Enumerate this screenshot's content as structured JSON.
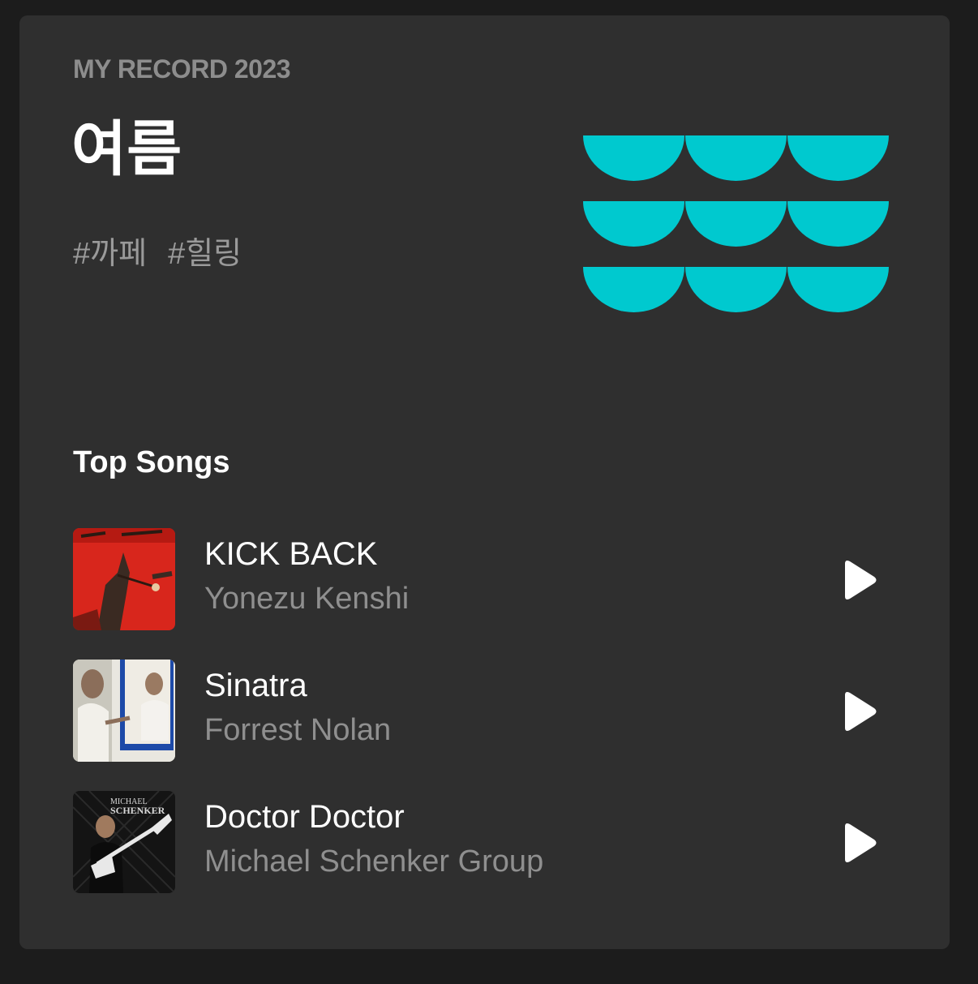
{
  "header": {
    "eyebrow": "MY RECORD 2023",
    "season": "여름",
    "tags": [
      "#까페",
      "#힐링"
    ]
  },
  "colors": {
    "accent": "#00c9cf",
    "card_bg": "#2f2f2f",
    "page_bg": "#1c1c1c"
  },
  "top_songs": {
    "title": "Top Songs",
    "items": [
      {
        "title": "KICK BACK",
        "artist": "Yonezu Kenshi",
        "cover_icon": "album-cover-red-figure"
      },
      {
        "title": "Sinatra",
        "artist": "Forrest Nolan",
        "cover_icon": "album-cover-mirror-photo"
      },
      {
        "title": "Doctor Doctor",
        "artist": "Michael Schenker Group",
        "cover_icon": "album-cover-guitarist"
      }
    ],
    "play_icon": "play-icon"
  }
}
